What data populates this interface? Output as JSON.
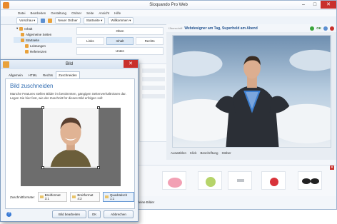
{
  "app": {
    "title": "Sioquando Pro Web",
    "menu": [
      "Datei",
      "Bearbeiten",
      "Gestaltung",
      "Ordner",
      "Seite",
      "Ansicht",
      "Hilfe"
    ],
    "toolbar": {
      "back": "Vorschau",
      "new_folder": "Neuer Ordner",
      "start_page": "Startseite",
      "welcome": "Willkommen"
    }
  },
  "tree": {
    "items": [
      "Inhalt",
      "Allgemeine Seiten",
      "Startseite",
      "Leistungen",
      "Referenzen"
    ]
  },
  "layout": {
    "top": "Oben",
    "left": "Links",
    "content": "Inhalt",
    "right": "Rechts",
    "bottom": "Unten"
  },
  "content": {
    "label": "Überschrift",
    "headline": "Webdesigner am Tag, Superheld am Abend",
    "ok": "OK",
    "image_toolbar": [
      "Auswählen",
      "Klick",
      "Beschriftung",
      "Stöber"
    ]
  },
  "bottom_tabs": [
    "Kleine Bilder"
  ],
  "dialog": {
    "title": "Bild",
    "tabs": [
      "Allgemein",
      "HTML",
      "Rechts",
      "Zuschneiden"
    ],
    "active_tab": "Zuschneiden",
    "heading": "Bild zuschneiden",
    "description": "Manche Features stellen Bilder im bestimmten, gängigen Seitenverhältnissen dar. Legen Sie hier fest, wie der Zuschnitt für dieses Bild erfolgen soll:",
    "formats_label": "Zuschnittformate:",
    "formats": [
      "Breitformat 3:1",
      "Breitformat 4:2",
      "Quadratisch 1:1"
    ],
    "selected_format": "Quadratisch 1:1",
    "buttons": {
      "edit": "Bild bearbeiten",
      "ok": "OK",
      "cancel": "Abbrechen"
    }
  },
  "colors": {
    "accent": "#2f6bb0",
    "close": "#c9302c",
    "folder": "#e9a23b"
  }
}
